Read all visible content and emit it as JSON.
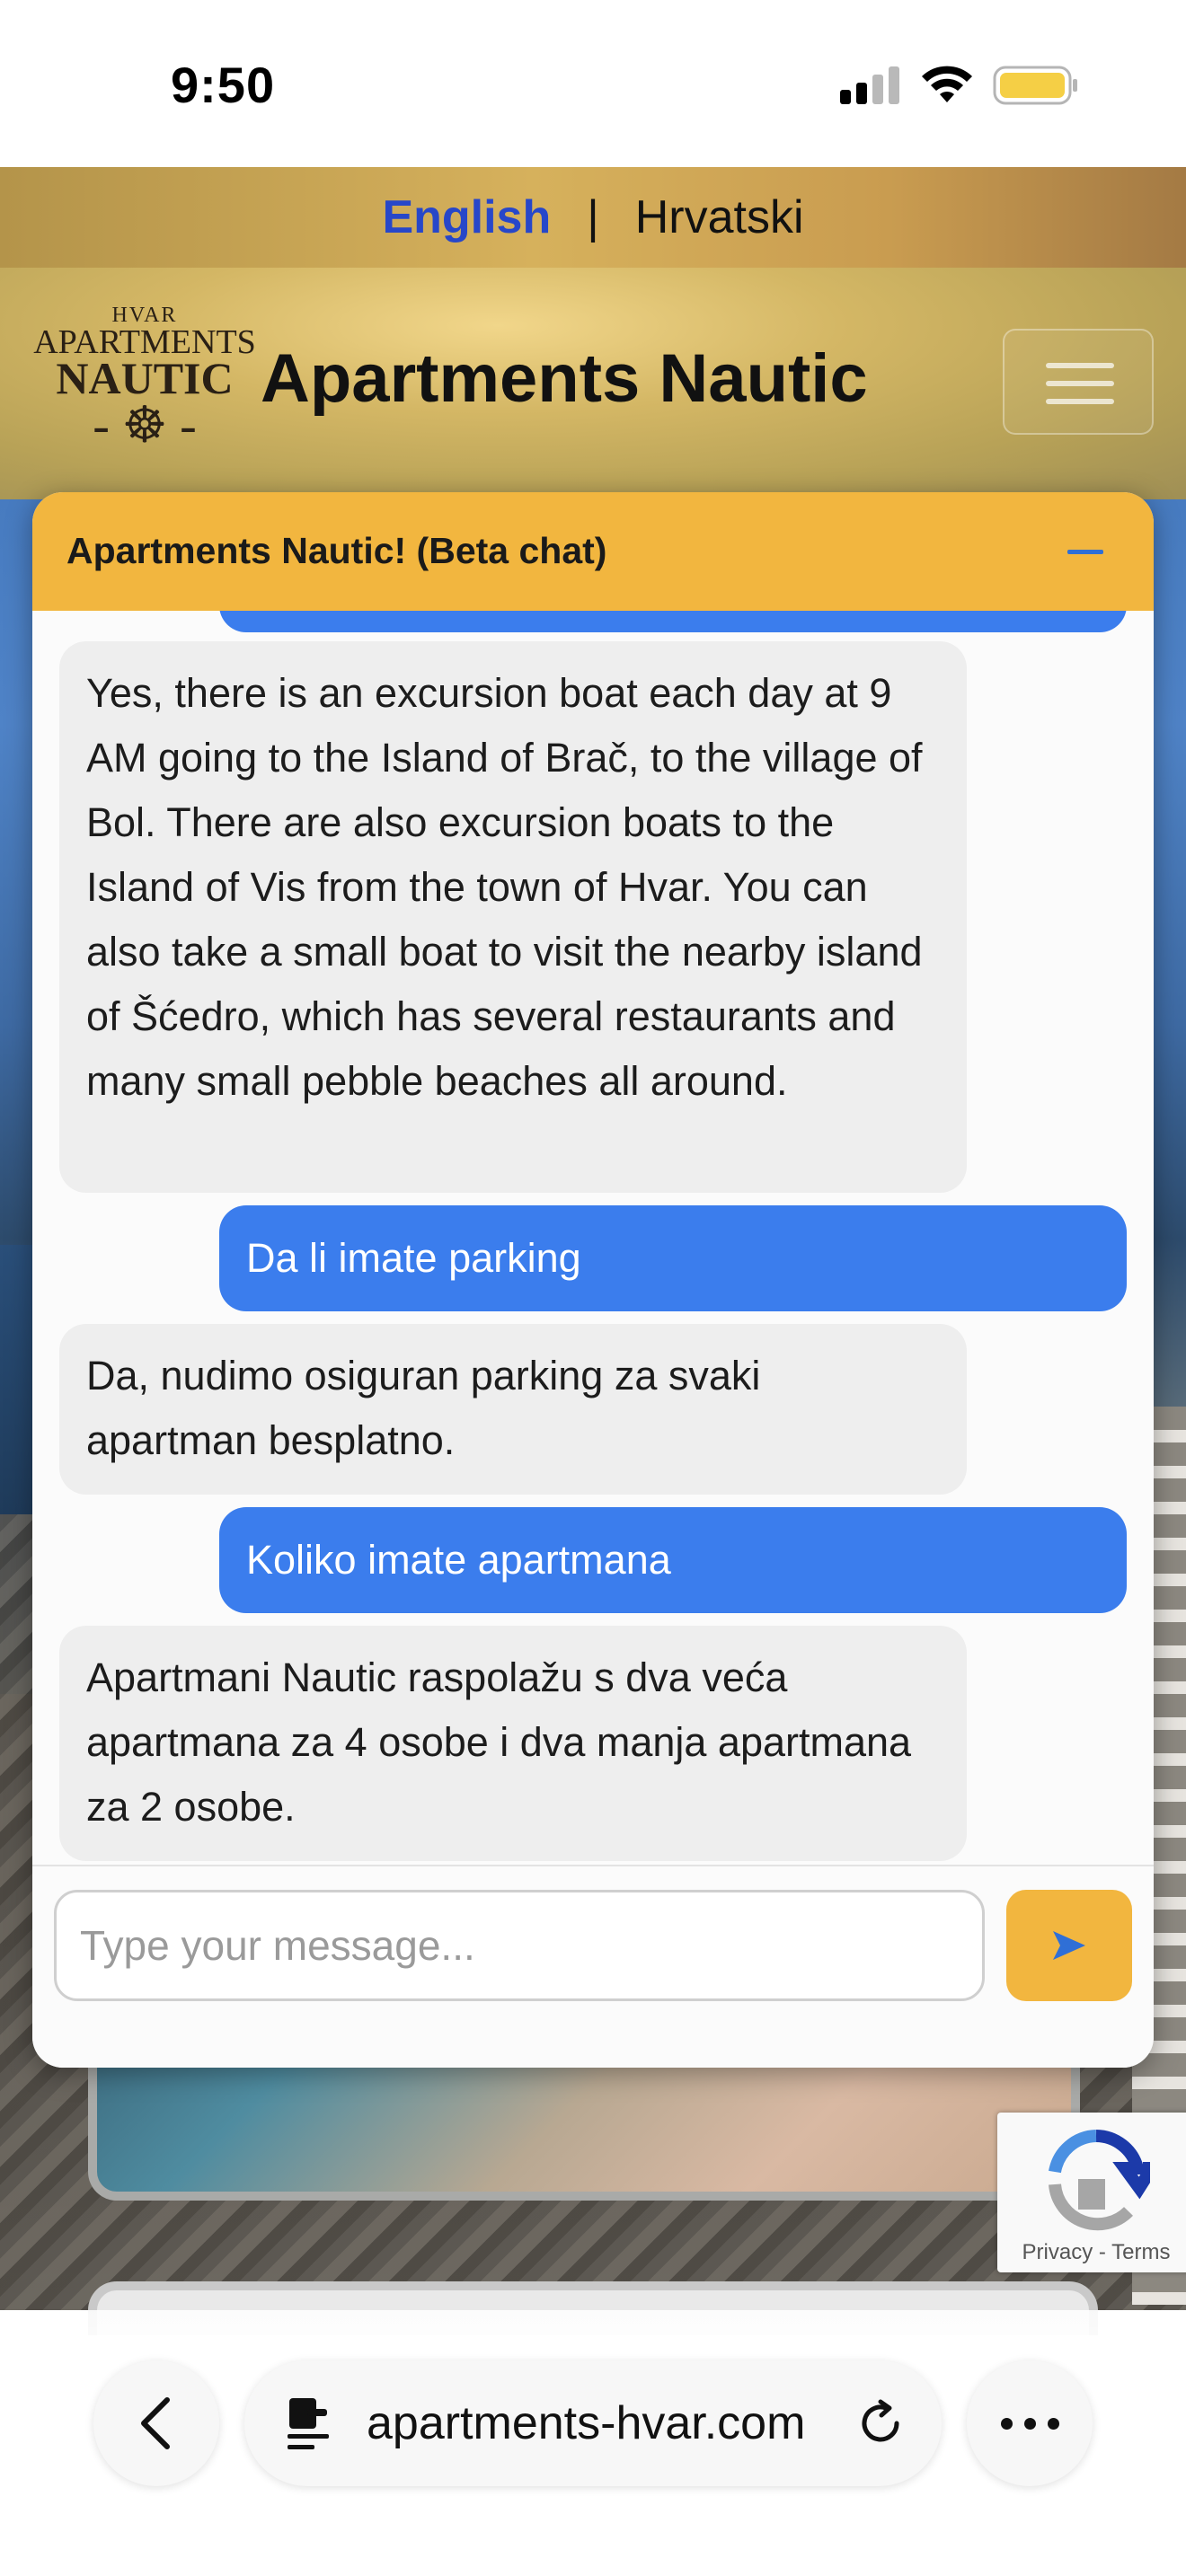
{
  "status_bar": {
    "time": "9:50",
    "icons": [
      "cellular-signal-icon",
      "wifi-icon",
      "battery-icon"
    ],
    "battery_color": "#f5cf45"
  },
  "language_bar": {
    "english": "English",
    "separator": "|",
    "croatian": "Hrvatski",
    "active_color": "#2747c9"
  },
  "header": {
    "logo": {
      "line1": "HVAR",
      "line2": "APARTMENTS",
      "line3": "NAUTIC",
      "emblem": "- ☸ -"
    },
    "title": "Apartments Nautic",
    "menu_icon": "hamburger-menu-icon"
  },
  "chat": {
    "title": "Apartments Nautic! (Beta chat)",
    "minimize_icon": "minimize-icon",
    "header_color": "#f2b63f",
    "user_bubble_color": "#3b7ded",
    "messages": [
      {
        "from": "bot",
        "text": "Yes, there is an excursion boat each day at 9 AM going to the Island of Brač, to the village of Bol. There are also excursion boats to the Island of Vis from the town of Hvar. You can also take a small boat to visit the nearby island of Šćedro, which has several restaurants and many small pebble beaches all around."
      },
      {
        "from": "user",
        "text": "Da li imate parking"
      },
      {
        "from": "bot",
        "text": "Da, nudimo osiguran parking za svaki apartman besplatno."
      },
      {
        "from": "user",
        "text": "Koliko imate apartmana"
      },
      {
        "from": "bot",
        "text": "Apartmani Nautic raspolažu s dva veća apartmana za 4 osobe i dva manja apartmana za 2 osobe."
      }
    ],
    "input": {
      "value": "",
      "placeholder": "Type your message..."
    },
    "send_icon": "send-arrow-icon"
  },
  "recaptcha": {
    "links": "Privacy - Terms"
  },
  "browser": {
    "url": "apartments-hvar.com",
    "back_icon": "chevron-left-icon",
    "page_icon": "page-settings-icon",
    "reload_icon": "reload-icon",
    "more_icon": "more-dots-icon"
  }
}
